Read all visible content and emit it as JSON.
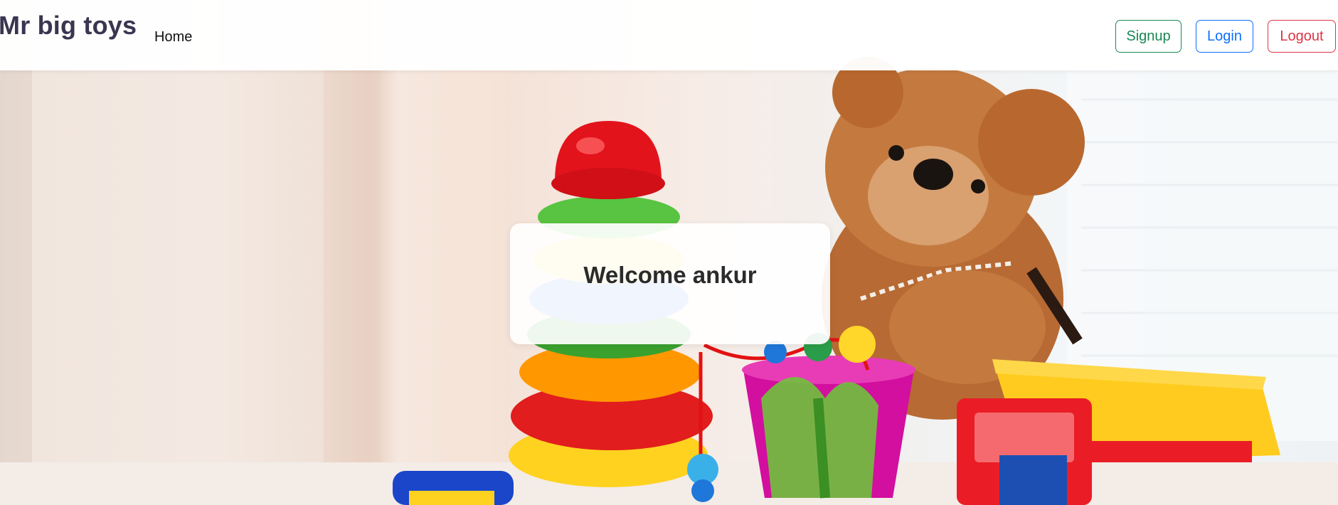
{
  "navbar": {
    "brand": "Mr big toys",
    "links": [
      {
        "label": "Home"
      }
    ],
    "buttons": {
      "signup": {
        "label": "Signup",
        "color": "#198754"
      },
      "login": {
        "label": "Login",
        "color": "#0d6efd"
      },
      "logout": {
        "label": "Logout",
        "color": "#dc3545"
      }
    }
  },
  "hero": {
    "image_subject": "toys-background",
    "welcome_text": "Welcome ankur"
  }
}
